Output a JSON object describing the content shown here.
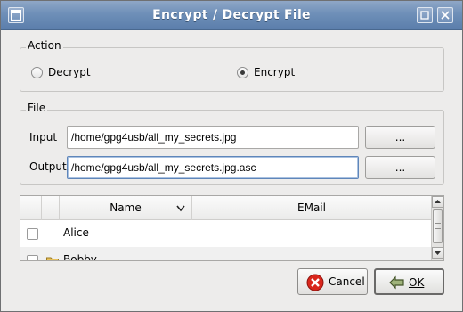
{
  "window": {
    "title": "Encrypt / Decrypt File"
  },
  "action": {
    "legend": "Action",
    "decrypt_label": "Decrypt",
    "encrypt_label": "Encrypt",
    "selected": "Encrypt"
  },
  "file": {
    "legend": "File",
    "input_label": "Input",
    "input_value": "/home/gpg4usb/all_my_secrets.jpg",
    "input_browse": "...",
    "output_label": "Output",
    "output_value": "/home/gpg4usb/all_my_secrets.jpg.asc",
    "output_browse": "..."
  },
  "keys_table": {
    "columns": [
      "Name",
      "EMail"
    ],
    "rows": [
      {
        "name": "Alice",
        "email": "",
        "checked": false
      },
      {
        "name": "Bobby",
        "email": "",
        "checked": false
      }
    ]
  },
  "buttons": {
    "cancel": "Cancel",
    "ok": "OK"
  },
  "colors": {
    "titlebar": "#6e8fb8",
    "cancel_icon": "#d9261c"
  },
  "icons": {
    "window_menu": "window-menu-icon",
    "maximize": "maximize-icon",
    "close": "close-icon",
    "sort": "chevron-down-icon",
    "folder": "folder-icon",
    "cancel": "cancel-icon",
    "ok": "ok-icon"
  }
}
